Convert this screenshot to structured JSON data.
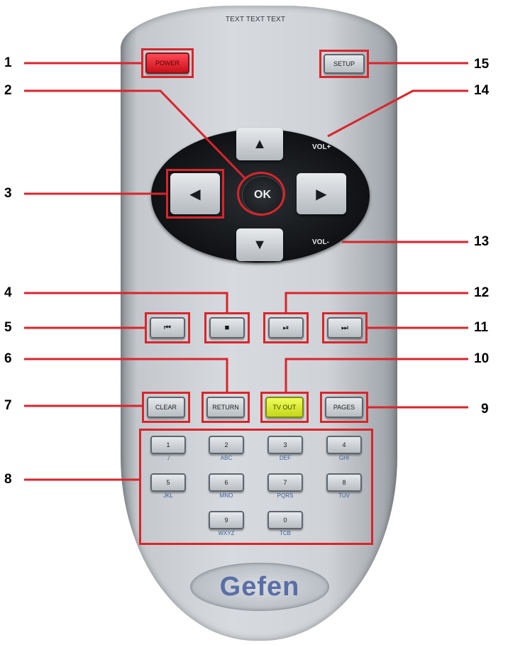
{
  "remote": {
    "top_label": "TEXT TEXT TEXT",
    "buttons": {
      "power": "POWER",
      "setup": "SETUP",
      "clear": "CLEAR",
      "return": "RETURN",
      "tv_out": "TV OUT",
      "pages": "PAGES"
    },
    "dpad": {
      "ok": "OK",
      "vol_up": "VOL+",
      "vol_down": "VOL-",
      "up_glyph": "▲",
      "down_glyph": "▼",
      "left_glyph": "◀",
      "right_glyph": "▶"
    },
    "transport": {
      "prev_glyph": "⏮",
      "stop_glyph": "■",
      "play_pause_glyph": "⏯",
      "next_glyph": "⏭"
    },
    "numbers": [
      {
        "digit": "1",
        "letters": "./"
      },
      {
        "digit": "2",
        "letters": "ABC"
      },
      {
        "digit": "3",
        "letters": "DEF"
      },
      {
        "digit": "4",
        "letters": "GHI"
      },
      {
        "digit": "5",
        "letters": "JKL"
      },
      {
        "digit": "6",
        "letters": "MNO"
      },
      {
        "digit": "7",
        "letters": "PQRS"
      },
      {
        "digit": "8",
        "letters": "TUV"
      },
      {
        "digit": "9",
        "letters": "WXYZ"
      },
      {
        "digit": "0",
        "letters": "TCB"
      }
    ],
    "logo": "Gefen"
  },
  "callouts": [
    "1",
    "2",
    "3",
    "4",
    "5",
    "6",
    "7",
    "8",
    "9",
    "10",
    "11",
    "12",
    "13",
    "14",
    "15"
  ],
  "colors": {
    "callout_red": "#d9252c",
    "power_red": "#e0202a",
    "tv_out_yellow": "#dff03a",
    "logo_blue": "#5a6ea6"
  }
}
